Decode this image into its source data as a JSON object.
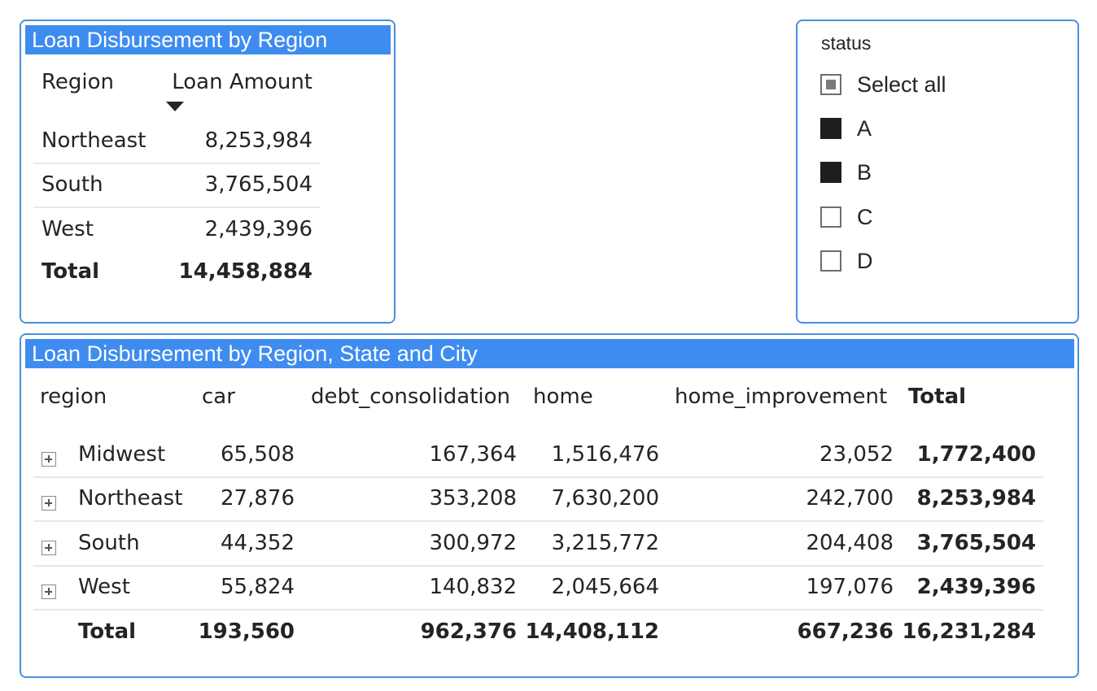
{
  "region_table": {
    "title": "Loan Disbursement by Region",
    "headers": [
      "Region",
      "Loan Amount"
    ],
    "rows": [
      {
        "region": "Northeast",
        "amount": "8,253,984"
      },
      {
        "region": "South",
        "amount": "3,765,504"
      },
      {
        "region": "West",
        "amount": "2,439,396"
      }
    ],
    "total": {
      "label": "Total",
      "amount": "14,458,884"
    }
  },
  "slicer": {
    "title": "status",
    "items": [
      {
        "label": "Select all",
        "state": "partial"
      },
      {
        "label": "A",
        "state": "checked"
      },
      {
        "label": "B",
        "state": "checked"
      },
      {
        "label": "C",
        "state": "unchecked"
      },
      {
        "label": "D",
        "state": "unchecked"
      }
    ]
  },
  "matrix": {
    "title": "Loan Disbursement by Region, State and City",
    "headers": [
      "region",
      "car",
      "debt_consolidation",
      "home",
      "home_improvement",
      "Total"
    ],
    "rows": [
      {
        "region": "Midwest",
        "car": "65,508",
        "debt_consolidation": "167,364",
        "home": "1,516,476",
        "home_improvement": "23,052",
        "total": "1,772,400"
      },
      {
        "region": "Northeast",
        "car": "27,876",
        "debt_consolidation": "353,208",
        "home": "7,630,200",
        "home_improvement": "242,700",
        "total": "8,253,984"
      },
      {
        "region": "South",
        "car": "44,352",
        "debt_consolidation": "300,972",
        "home": "3,215,772",
        "home_improvement": "204,408",
        "total": "3,765,504"
      },
      {
        "region": "West",
        "car": "55,824",
        "debt_consolidation": "140,832",
        "home": "2,045,664",
        "home_improvement": "197,076",
        "total": "2,439,396"
      }
    ],
    "total": {
      "label": "Total",
      "car": "193,560",
      "debt_consolidation": "962,376",
      "home": "14,408,112",
      "home_improvement": "667,236",
      "total": "16,231,284"
    }
  },
  "colors": {
    "accent": "#3f8cf0",
    "border": "#4a8fe0"
  }
}
